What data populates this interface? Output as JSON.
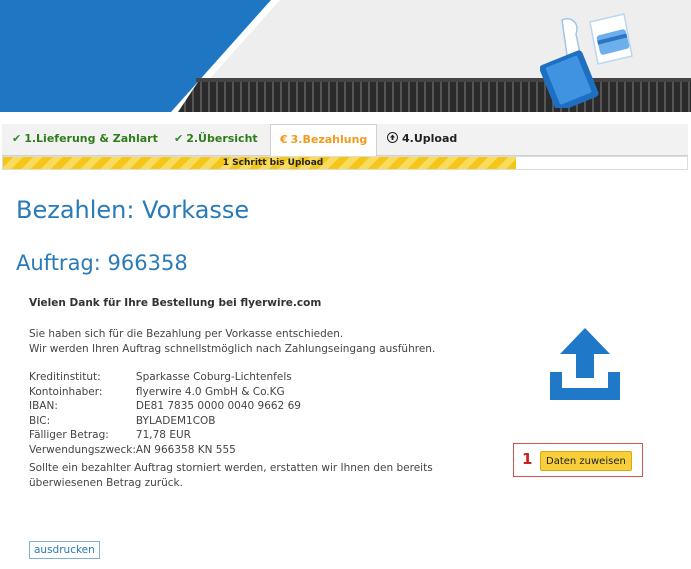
{
  "tabs": [
    {
      "label": "1.Lieferung & Zahlart",
      "state": "done"
    },
    {
      "label": "2.Übersicht",
      "state": "done"
    },
    {
      "label": "3.Bezahlung",
      "state": "active"
    },
    {
      "label": "4.Upload",
      "state": "next"
    }
  ],
  "icons": {
    "done": "checkmark-icon",
    "active": "euro-icon",
    "next": "upload-circle-icon"
  },
  "progress": {
    "label": "1 Schritt bis Upload",
    "value_fraction": 0.75
  },
  "page": {
    "title": "Bezahlen: Vorkasse",
    "order": "Auftrag: 966358",
    "thanks": "Vielen Dank für Ihre Bestellung bei flyerwire.com",
    "intro_line1": "Sie haben sich für die Bezahlung per Vorkasse entschieden.",
    "intro_line2": "Wir werden Ihren Auftrag schnellstmöglich nach Zahlungseingang ausführen.",
    "storno_line1": "Sollte ein bezahlter Auftrag storniert werden, erstatten wir Ihnen den bereits",
    "storno_line2": "überwiesenen Betrag zurück."
  },
  "bank": [
    {
      "label": "Kreditinstitut:",
      "value": "Sparkasse Coburg-Lichtenfels"
    },
    {
      "label": "Kontoinhaber:",
      "value": "flyerwire 4.0 GmbH & Co.KG"
    },
    {
      "label": "IBAN:",
      "value": "DE81 7835 0000 0040 9662 69"
    },
    {
      "label": "BIC:",
      "value": "BYLADEM1COB"
    },
    {
      "label": "Fälliger Betrag:",
      "value": "71,78 EUR"
    },
    {
      "label": "Verwendungszweck:",
      "value": "AN 966358 KN 555"
    }
  ],
  "assign": {
    "number": "1",
    "button": "Daten zuweisen"
  },
  "print_button": "ausdrucken",
  "colors": {
    "heading": "#2a7ab8",
    "done": "#2e7d1a",
    "active": "#f29a1c",
    "highlight": "#f8cf3a",
    "banner": "#1f77c3"
  }
}
